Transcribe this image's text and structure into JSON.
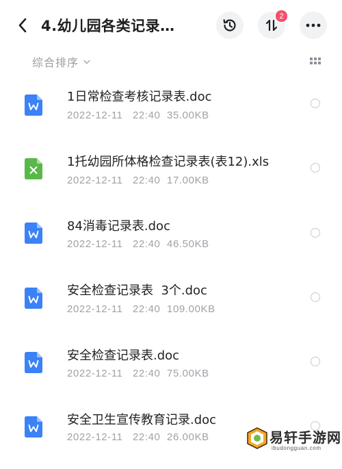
{
  "header": {
    "title": "4.幼儿园各类记录…",
    "transfer_badge": "2"
  },
  "toolbar": {
    "sort_label": "综合排序"
  },
  "files": [
    {
      "name": "1日常检查考核记录表.doc",
      "date": "2022-12-11",
      "time": "22:40",
      "size": "35.00KB",
      "icon": "word-doc-icon",
      "icon_color": "#3b82f6"
    },
    {
      "name": "1托幼园所体格检查记录表(表12).xls",
      "date": "2022-12-11",
      "time": "22:40",
      "size": "17.00KB",
      "icon": "excel-xls-icon",
      "icon_color": "#5ab84a"
    },
    {
      "name": "84消毒记录表.doc",
      "date": "2022-12-11",
      "time": "22:40",
      "size": "46.50KB",
      "icon": "word-doc-icon",
      "icon_color": "#3b82f6"
    },
    {
      "name": "安全检查记录表  3个.doc",
      "date": "2022-12-11",
      "time": "22:40",
      "size": "109.00KB",
      "icon": "word-doc-icon",
      "icon_color": "#3b82f6"
    },
    {
      "name": "安全检查记录表.doc",
      "date": "2022-12-11",
      "time": "22:40",
      "size": "75.00KB",
      "icon": "word-doc-icon",
      "icon_color": "#3b82f6"
    },
    {
      "name": "安全卫生宣传教育记录.doc",
      "date": "2022-12-11",
      "time": "22:40",
      "size": "26.00KB",
      "icon": "word-doc-icon",
      "icon_color": "#3b82f6"
    }
  ],
  "watermark": {
    "name": "易轩手游网",
    "url": "ibudongguan.com"
  }
}
